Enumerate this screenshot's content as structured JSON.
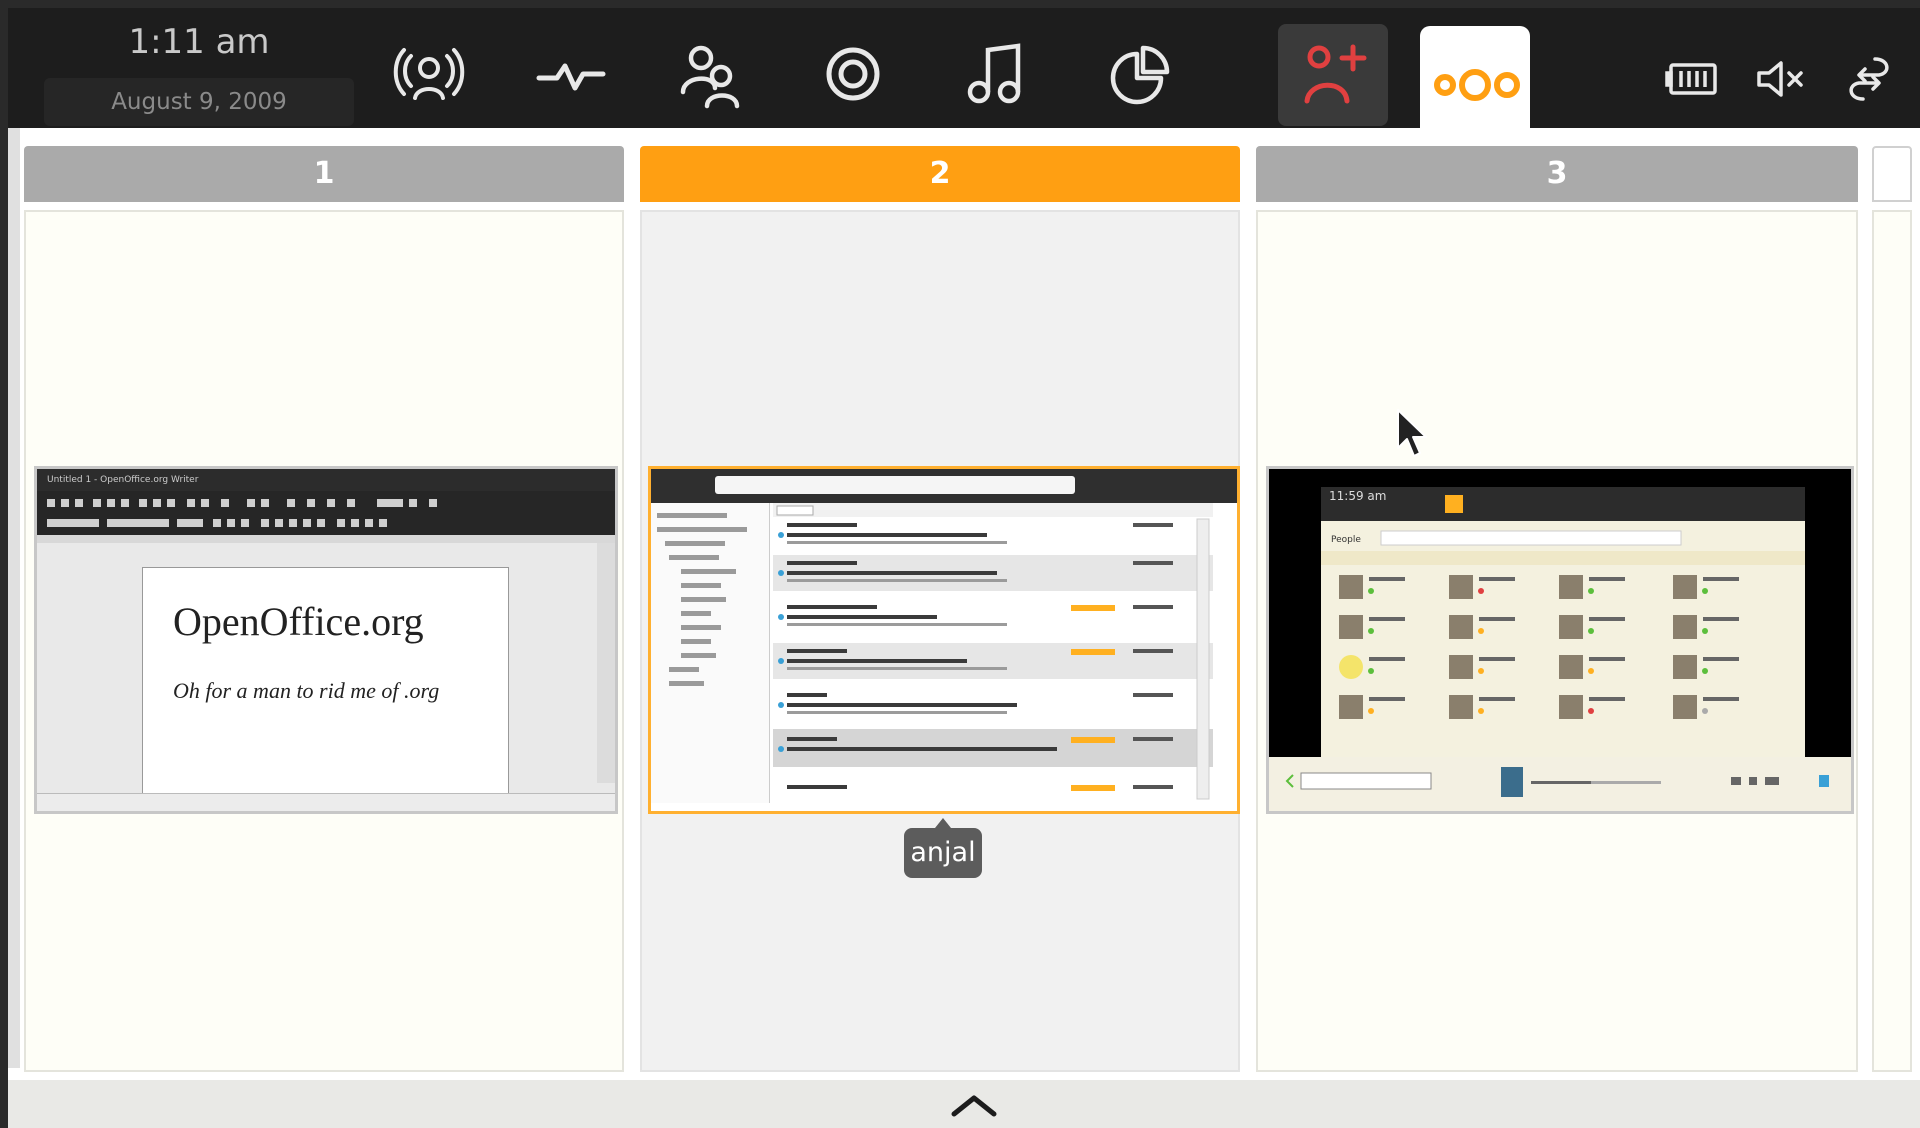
{
  "clock": {
    "time": "1:11 am",
    "date": "August  9, 2009"
  },
  "navbar": {
    "items": [
      {
        "name": "status-icon"
      },
      {
        "name": "activity-icon"
      },
      {
        "name": "people-icon"
      },
      {
        "name": "web-icon"
      },
      {
        "name": "media-icon"
      },
      {
        "name": "pasteboard-icon"
      },
      {
        "name": "applications-icon"
      },
      {
        "name": "zones-icon"
      }
    ],
    "accent_red": "#e04040",
    "accent_orange": "#ff9f12"
  },
  "status": [
    "battery-icon",
    "volume-muted-icon",
    "network-icon"
  ],
  "zones": [
    {
      "number": "1",
      "app": "openoffice-writer"
    },
    {
      "number": "2",
      "app": "anjal"
    },
    {
      "number": "3",
      "app": "moblin-panel"
    }
  ],
  "thumb1": {
    "window_title": "Untitled 1 - OpenOffice.org Writer",
    "doc_title": "OpenOffice.org",
    "doc_subtitle": "Oh for a man to rid me of .org"
  },
  "tooltip": {
    "label": "anjal"
  },
  "thumb3": {
    "time": "11:59 am",
    "people_label": "People"
  },
  "colors": {
    "active_zone": "#ff9f12",
    "inactive_zone": "#aaaaaa"
  }
}
